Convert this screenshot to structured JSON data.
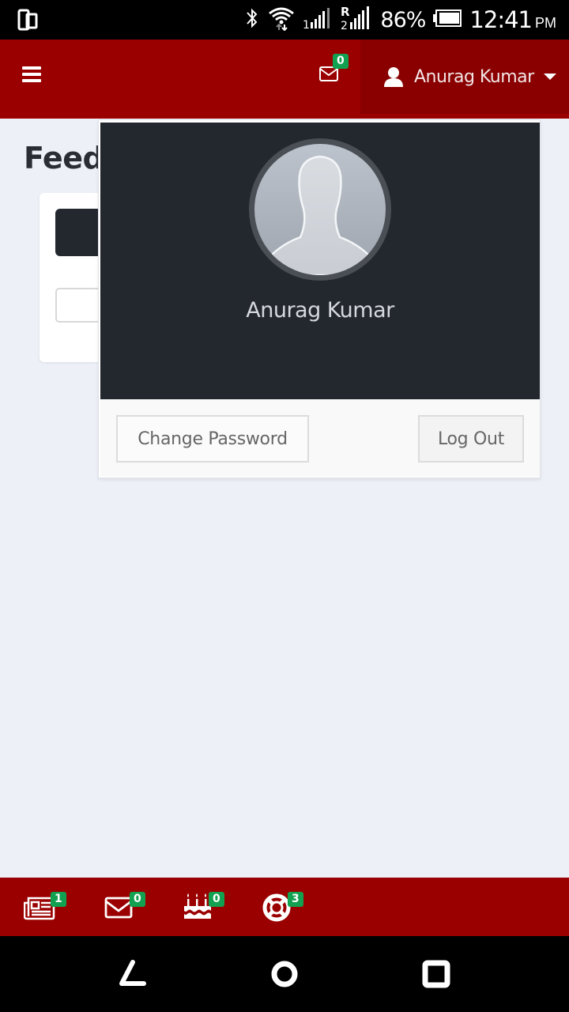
{
  "status_bar": {
    "battery_percent": "86%",
    "time": "12:41",
    "ampm": "PM",
    "icons": [
      "screen-mirror-icon",
      "bluetooth-icon",
      "wifi-icon",
      "signal-sim1-icon",
      "signal-sim2-roaming-icon",
      "battery-icon"
    ]
  },
  "header": {
    "menu_icon": "hamburger-icon",
    "messages_badge": "0",
    "user_name": "Anurag Kumar",
    "brand_color": "#9b0000"
  },
  "page": {
    "title": "Feedback"
  },
  "user_dropdown": {
    "name": "Anurag Kumar",
    "avatar": "default-profile-silhouette",
    "change_password_label": "Change Password",
    "logout_label": "Log Out"
  },
  "bottom_bar": {
    "items": [
      {
        "icon": "newspaper-icon",
        "badge": "1"
      },
      {
        "icon": "envelope-icon",
        "badge": "0"
      },
      {
        "icon": "birthday-cake-icon",
        "badge": "0"
      },
      {
        "icon": "life-ring-icon",
        "badge": "3"
      }
    ],
    "badge_color": "#12a150"
  },
  "nav_bar": {
    "back": "back-icon",
    "home": "home-icon",
    "recents": "recents-icon"
  }
}
